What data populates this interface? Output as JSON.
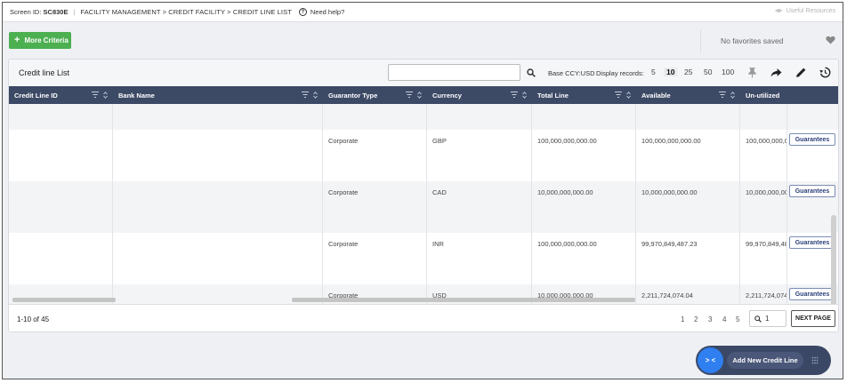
{
  "topbar": {
    "screen_id_label": "Screen ID:",
    "screen_id": "SC830E",
    "breadcrumb": "FACILITY MANAGEMENT > CREDIT FACILITY > CREDIT LINE LIST",
    "help": "Need help?",
    "useful": "Useful Resources"
  },
  "criteria": {
    "label": "More Criteria"
  },
  "favorites": {
    "label": "No favorites saved"
  },
  "panel": {
    "title": "Credit line List",
    "search_value": "",
    "base_ccy": "Base CCY:USD",
    "display_label": "Display records:",
    "page_sizes": [
      "5",
      "10",
      "25",
      "50",
      "100"
    ],
    "active_page_size": "10"
  },
  "columns": [
    {
      "label": "Credit Line ID"
    },
    {
      "label": "Bank Name"
    },
    {
      "label": "Guarantor Type"
    },
    {
      "label": "Currency"
    },
    {
      "label": "Total Line"
    },
    {
      "label": "Available"
    },
    {
      "label": "Un-utilized"
    }
  ],
  "rows": [
    {
      "guarantor": "",
      "currency": "",
      "total": "",
      "available": "",
      "unutilized": "",
      "action": ""
    },
    {
      "guarantor": "Corporate",
      "currency": "GBP",
      "total": "100,000,000,000.00",
      "available": "100,000,000,000.00",
      "unutilized": "100,000,000,0(",
      "action": "Guarantees"
    },
    {
      "guarantor": "Corporate",
      "currency": "CAD",
      "total": "10,000,000,000.00",
      "available": "10,000,000,000.00",
      "unutilized": "10,000,000,00(",
      "action": "Guarantees"
    },
    {
      "guarantor": "Corporate",
      "currency": "INR",
      "total": "100,000,000,000.00",
      "available": "99,970,849,487.23",
      "unutilized": "99,970,849,48",
      "action": "Guarantees"
    },
    {
      "guarantor": "Corporate",
      "currency": "USD",
      "total": "10,000,000,000.00",
      "available": "2,211,724,074.04",
      "unutilized": "2,211,724,074.",
      "action": "Guarantees"
    }
  ],
  "footer": {
    "count": "1-10 of 45",
    "pages": [
      "1",
      "2",
      "3",
      "4",
      "5"
    ],
    "goto_value": "1",
    "next": "NEXT PAGE"
  },
  "fab": {
    "toggle": "> <",
    "add": "Add New Credit Line"
  },
  "colors": {
    "header_bg": "#3d4a66",
    "green": "#4caf50",
    "fab_bg": "#3a4866",
    "fab_blue": "#2f7ff0"
  }
}
